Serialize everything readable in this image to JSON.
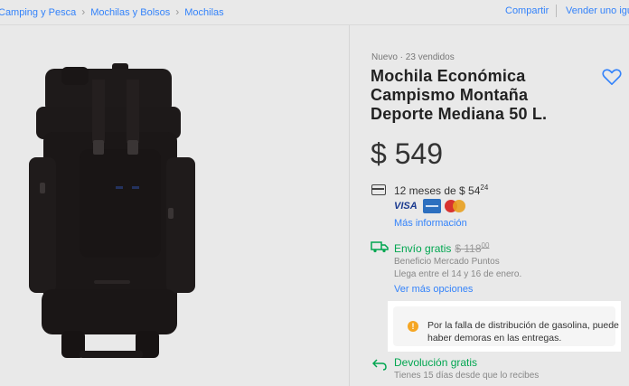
{
  "breadcrumb": {
    "items": [
      "Camping y Pesca",
      "Mochilas y Bolsos",
      "Mochilas"
    ],
    "separator": "›"
  },
  "header_actions": {
    "share": "Compartir",
    "sell": "Vender uno igual"
  },
  "product": {
    "condition": "Nuevo  ·  23 vendidos",
    "title": "Mochila Económica Campismo Montaña Deporte Mediana 50 L.",
    "price": "$ 549",
    "installments_prefix": "12 meses de $ 54",
    "installments_cents": "24",
    "payment_brands": {
      "visa": "VISA",
      "amex_icon": "amex-icon",
      "mastercard_icon": "mastercard-icon"
    },
    "more_info": "Más información"
  },
  "shipping": {
    "label": "Envío gratis",
    "old_price": "$ 118",
    "old_price_cents": "00",
    "benefit": "Beneficio Mercado Puntos",
    "arrival": "Llega entre el 14 y 16 de enero.",
    "more_options": "Ver más opciones"
  },
  "notice": {
    "icon": "warning-icon",
    "text": "Por la falla de distribución de gasolina, puede haber demoras en las entregas."
  },
  "returns": {
    "label": "Devolución gratis",
    "subtext": "Tienes 15 días desde que lo recibes"
  },
  "colors": {
    "link": "#3483fa",
    "success": "#00a650",
    "warning": "#f5a623",
    "background": "#e9e9e9"
  }
}
